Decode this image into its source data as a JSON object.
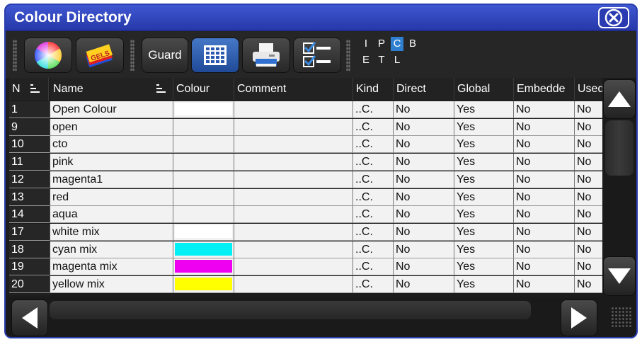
{
  "window": {
    "title": "Colour Directory"
  },
  "toolbar": {
    "guard_label": "Guard",
    "filters": [
      "I",
      "P",
      "C",
      "B",
      "E",
      "T",
      "L"
    ],
    "active_filter": "C"
  },
  "table": {
    "columns": [
      "N",
      "Name",
      "Colour",
      "Comment",
      "Kind",
      "Direct",
      "Global",
      "Embedde",
      "Used"
    ],
    "rows": [
      {
        "n": "1",
        "name": "Open Colour",
        "colour": "#ffffff",
        "comment": "",
        "kind": "..C.",
        "direct": "No",
        "global": "Yes",
        "embedded": "No",
        "used": "No"
      },
      {
        "n": "9",
        "name": "open",
        "colour": "",
        "comment": "",
        "kind": "..C.",
        "direct": "No",
        "global": "Yes",
        "embedded": "No",
        "used": "No"
      },
      {
        "n": "10",
        "name": "cto",
        "colour": "",
        "comment": "",
        "kind": "..C.",
        "direct": "No",
        "global": "Yes",
        "embedded": "No",
        "used": "No"
      },
      {
        "n": "11",
        "name": "pink",
        "colour": "",
        "comment": "",
        "kind": "..C.",
        "direct": "No",
        "global": "Yes",
        "embedded": "No",
        "used": "No"
      },
      {
        "n": "12",
        "name": "magenta1",
        "colour": "",
        "comment": "",
        "kind": "..C.",
        "direct": "No",
        "global": "Yes",
        "embedded": "No",
        "used": "No"
      },
      {
        "n": "13",
        "name": "red",
        "colour": "",
        "comment": "",
        "kind": "..C.",
        "direct": "No",
        "global": "Yes",
        "embedded": "No",
        "used": "No"
      },
      {
        "n": "14",
        "name": "aqua",
        "colour": "",
        "comment": "",
        "kind": "..C.",
        "direct": "No",
        "global": "Yes",
        "embedded": "No",
        "used": "No"
      },
      {
        "n": "17",
        "name": "white mix",
        "colour": "#ffffff",
        "comment": "",
        "kind": "..C.",
        "direct": "No",
        "global": "Yes",
        "embedded": "No",
        "used": "No"
      },
      {
        "n": "18",
        "name": "cyan mix",
        "colour": "#00f0f5",
        "comment": "",
        "kind": "..C.",
        "direct": "No",
        "global": "Yes",
        "embedded": "No",
        "used": "No"
      },
      {
        "n": "19",
        "name": "magenta mix",
        "colour": "#f000f0",
        "comment": "",
        "kind": "..C.",
        "direct": "No",
        "global": "Yes",
        "embedded": "No",
        "used": "No"
      },
      {
        "n": "20",
        "name": "yellow mix",
        "colour": "#ffff00",
        "comment": "",
        "kind": "..C.",
        "direct": "No",
        "global": "Yes",
        "embedded": "No",
        "used": "No"
      }
    ]
  },
  "colors": {
    "title_bar": "#2f45c0",
    "accent": "#2f7fd0"
  },
  "icons": {
    "toolbar": [
      "colour-wheel-icon",
      "gels-icon",
      "sheet-view-icon",
      "print-icon",
      "checklist-icon"
    ],
    "scroll": [
      "arrow-up-icon",
      "arrow-down-icon",
      "arrow-left-icon",
      "arrow-right-icon"
    ]
  }
}
